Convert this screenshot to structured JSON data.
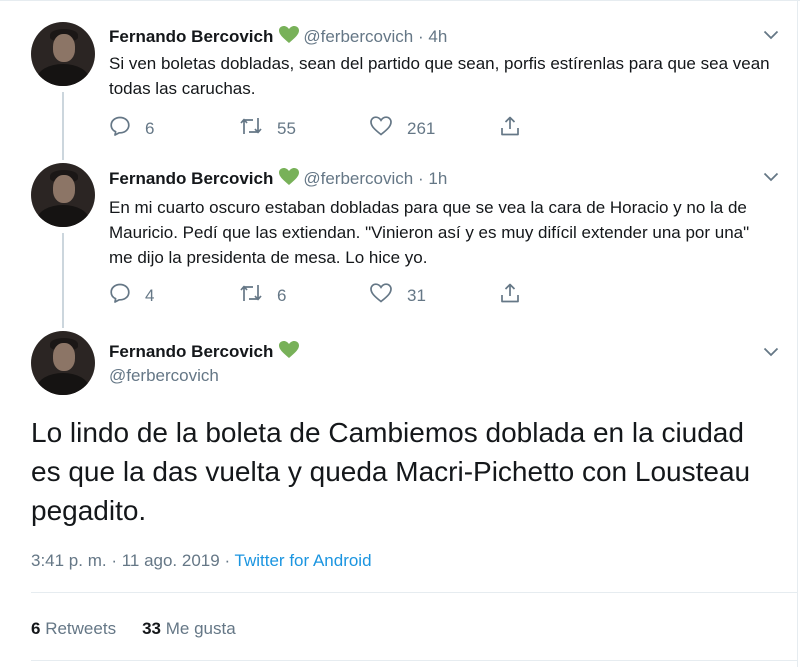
{
  "tweets": [
    {
      "name": "Fernando Bercovich",
      "handle": "@ferbercovich",
      "separator": "·",
      "time": "4h",
      "text": "Si ven boletas dobladas, sean del partido que sean, porfis estírenlas para que sea vean todas las caruchas.",
      "replies": "6",
      "retweets": "55",
      "likes": "261"
    },
    {
      "name": "Fernando Bercovich",
      "handle": "@ferbercovich",
      "separator": "·",
      "time": "1h",
      "text": "En mi cuarto oscuro estaban dobladas para que se vea la cara de Horacio y no la de Mauricio. Pedí que las extiendan. \"Vinieron así y es muy difícil extender una por una\" me dijo la presidenta de mesa. Lo hice yo.",
      "replies": "4",
      "retweets": "6",
      "likes": "31"
    }
  ],
  "main_tweet": {
    "name": "Fernando Bercovich",
    "handle": "@ferbercovich",
    "text": "Lo lindo de la boleta de Cambiemos doblada en la ciudad es que la das vuelta y queda Macri-Pichetto con Lousteau pegadito.",
    "timestamp": "3:41 p. m. · 11 ago. 2019",
    "meta_separator": "·",
    "source": "Twitter for Android",
    "retweets_count": "6",
    "retweets_label": "Retweets",
    "likes_count": "33",
    "likes_label": "Me gusta"
  },
  "icons": {
    "verified_heart": "green-heart-icon",
    "reply": "reply-icon",
    "retweet": "retweet-icon",
    "like": "like-icon",
    "share": "share-icon",
    "menu": "chevron-down-icon"
  },
  "colors": {
    "heart": "#78b159",
    "link": "#1b95e0",
    "muted": "#657786",
    "thread_line": "#ccd6dd"
  }
}
